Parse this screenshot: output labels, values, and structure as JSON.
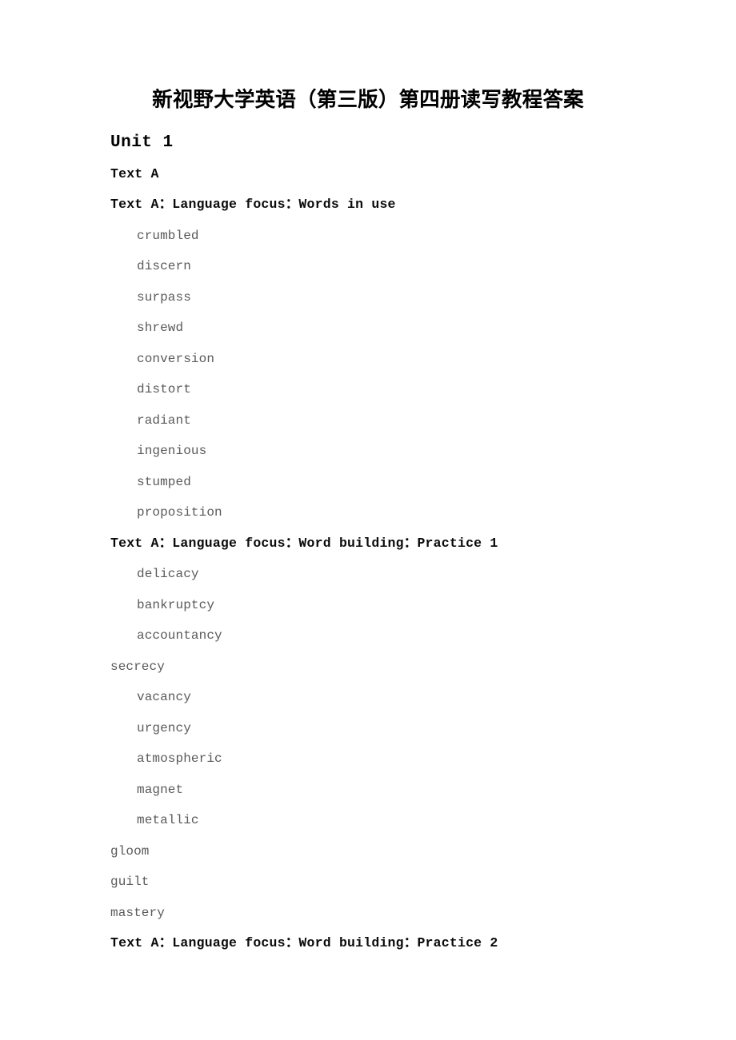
{
  "document": {
    "title": "新视野大学英语（第三版）第四册读写教程答案",
    "unit_heading": "Unit 1"
  },
  "colors": {
    "page_background": "#ffffff",
    "heading_text": "#000000",
    "section_header_text": "#0b0b0b",
    "word_item_text": "#5a5a5a"
  },
  "content_lines": [
    {
      "kind": "section-header",
      "indent": false,
      "text": "Text A"
    },
    {
      "kind": "section-header",
      "indent": false,
      "text": "Text A：Language focus：Words in use"
    },
    {
      "kind": "word-item",
      "indent": true,
      "text": "crumbled"
    },
    {
      "kind": "word-item",
      "indent": true,
      "text": "discern"
    },
    {
      "kind": "word-item",
      "indent": true,
      "text": "surpass"
    },
    {
      "kind": "word-item",
      "indent": true,
      "text": "shrewd"
    },
    {
      "kind": "word-item",
      "indent": true,
      "text": "conversion"
    },
    {
      "kind": "word-item",
      "indent": true,
      "text": "distort"
    },
    {
      "kind": "word-item",
      "indent": true,
      "text": "radiant"
    },
    {
      "kind": "word-item",
      "indent": true,
      "text": "ingenious"
    },
    {
      "kind": "word-item",
      "indent": true,
      "text": "stumped"
    },
    {
      "kind": "word-item",
      "indent": true,
      "text": "proposition"
    },
    {
      "kind": "section-header",
      "indent": false,
      "text": "Text A：Language focus：Word building：Practice 1"
    },
    {
      "kind": "word-item",
      "indent": true,
      "text": "delicacy"
    },
    {
      "kind": "word-item",
      "indent": true,
      "text": "bankruptcy"
    },
    {
      "kind": "word-item",
      "indent": true,
      "text": "accountancy"
    },
    {
      "kind": "word-item",
      "indent": false,
      "text": "secrecy"
    },
    {
      "kind": "word-item",
      "indent": true,
      "text": "vacancy"
    },
    {
      "kind": "word-item",
      "indent": true,
      "text": "urgency"
    },
    {
      "kind": "word-item",
      "indent": true,
      "text": "atmospheric"
    },
    {
      "kind": "word-item",
      "indent": true,
      "text": "magnet"
    },
    {
      "kind": "word-item",
      "indent": true,
      "text": "metallic"
    },
    {
      "kind": "word-item",
      "indent": false,
      "text": "gloom"
    },
    {
      "kind": "word-item",
      "indent": false,
      "text": "guilt"
    },
    {
      "kind": "word-item",
      "indent": false,
      "text": "mastery"
    },
    {
      "kind": "section-header",
      "indent": false,
      "text": "Text A：Language focus：Word building：Practice 2"
    }
  ]
}
